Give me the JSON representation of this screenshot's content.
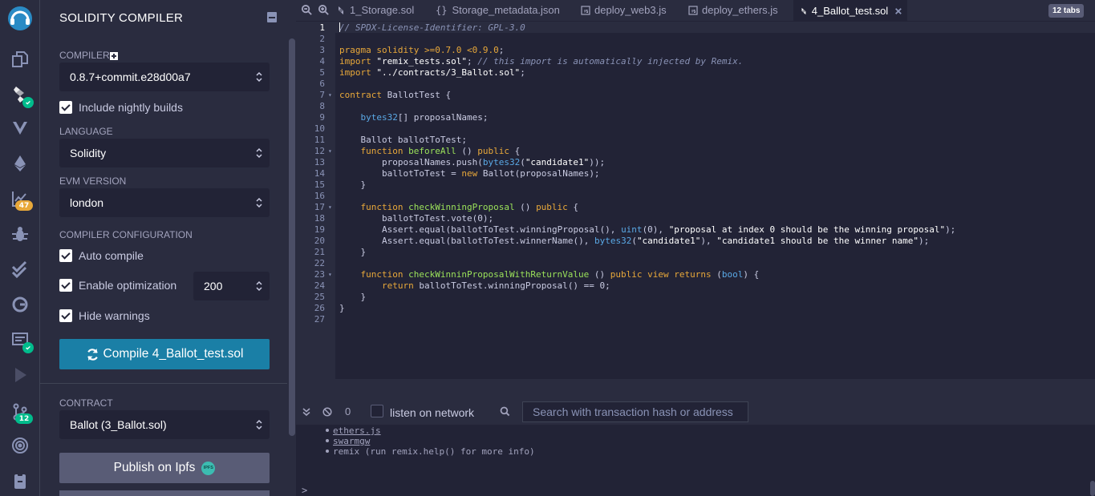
{
  "sidebar_icons": [
    {
      "name": "remix-logo-icon"
    },
    {
      "name": "file-explorer-icon"
    },
    {
      "name": "solidity-compiler-icon"
    },
    {
      "name": "vyper-icon"
    },
    {
      "name": "deploy-run-icon"
    },
    {
      "name": "analysis-icon",
      "badge": "47",
      "badge_color": "#e8a83a"
    },
    {
      "name": "debugger-icon"
    },
    {
      "name": "unit-testing-icon"
    },
    {
      "name": "plugin-g-icon"
    },
    {
      "name": "terminal-plugin-icon"
    },
    {
      "name": "play-icon"
    },
    {
      "name": "git-icon",
      "badge": "12",
      "badge_color": "#00bc8c"
    },
    {
      "name": "circle-plugin-icon"
    },
    {
      "name": "clipboard-plugin-icon"
    }
  ],
  "panel": {
    "title": "SOLIDITY COMPILER",
    "compiler_label": "COMPILER",
    "compiler_version": "0.8.7+commit.e28d00a7",
    "nightly_label": "Include nightly builds",
    "language_label": "LANGUAGE",
    "language_value": "Solidity",
    "evm_label": "EVM VERSION",
    "evm_value": "london",
    "config_label": "COMPILER CONFIGURATION",
    "auto_compile_label": "Auto compile",
    "optimization_label": "Enable optimization",
    "optimization_runs": "200",
    "hide_warnings_label": "Hide warnings",
    "compile_button": "Compile 4_Ballot_test.sol",
    "contract_label": "CONTRACT",
    "contract_value": "Ballot (3_Ballot.sol)",
    "publish_button": "Publish on Ipfs",
    "ipfs_badge": "IPFS"
  },
  "tabs": [
    {
      "label": "1_Storage.sol",
      "icon": "solidity-file-icon"
    },
    {
      "label": "Storage_metadata.json",
      "icon": "json-file-icon"
    },
    {
      "label": "deploy_web3.js",
      "icon": "js-file-icon"
    },
    {
      "label": "deploy_ethers.js",
      "icon": "js-file-icon"
    },
    {
      "label": "4_Ballot_test.sol",
      "icon": "solidity-file-icon",
      "active": true
    }
  ],
  "tab_count": "12 tabs",
  "editor": {
    "line_numbers": [
      "1",
      "2",
      "3",
      "4",
      "5",
      "6",
      "7",
      "8",
      "9",
      "10",
      "11",
      "12",
      "13",
      "14",
      "15",
      "16",
      "17",
      "18",
      "19",
      "20",
      "21",
      "22",
      "23",
      "24",
      "25",
      "26",
      "27"
    ],
    "lines": [
      "// SPDX-License-Identifier: GPL-3.0",
      "",
      "pragma solidity >=0.7.0 <0.9.0;",
      "import \"remix_tests.sol\"; // this import is automatically injected by Remix.",
      "import \"../contracts/3_Ballot.sol\";",
      "",
      "contract BallotTest {",
      "",
      "    bytes32[] proposalNames;",
      "",
      "    Ballot ballotToTest;",
      "    function beforeAll () public {",
      "        proposalNames.push(bytes32(\"candidate1\"));",
      "        ballotToTest = new Ballot(proposalNames);",
      "    }",
      "",
      "    function checkWinningProposal () public {",
      "        ballotToTest.vote(0);",
      "        Assert.equal(ballotToTest.winningProposal(), uint(0), \"proposal at index 0 should be the winning proposal\");",
      "        Assert.equal(ballotToTest.winnerName(), bytes32(\"candidate1\"), \"candidate1 should be the winner name\");",
      "    }",
      "",
      "    function checkWinninProposalWithReturnValue () public view returns (bool) {",
      "        return ballotToTest.winningProposal() == 0;",
      "    }",
      "}",
      ""
    ],
    "fold_lines": [
      "7",
      "12",
      "17",
      "23"
    ]
  },
  "terminal": {
    "count": "0",
    "listen_label": "listen on network",
    "search_placeholder": "Search with transaction hash or address",
    "lines": [
      "ethers.js",
      "swarmgw",
      "remix (run remix.help() for more info)"
    ],
    "prompt": ">"
  }
}
